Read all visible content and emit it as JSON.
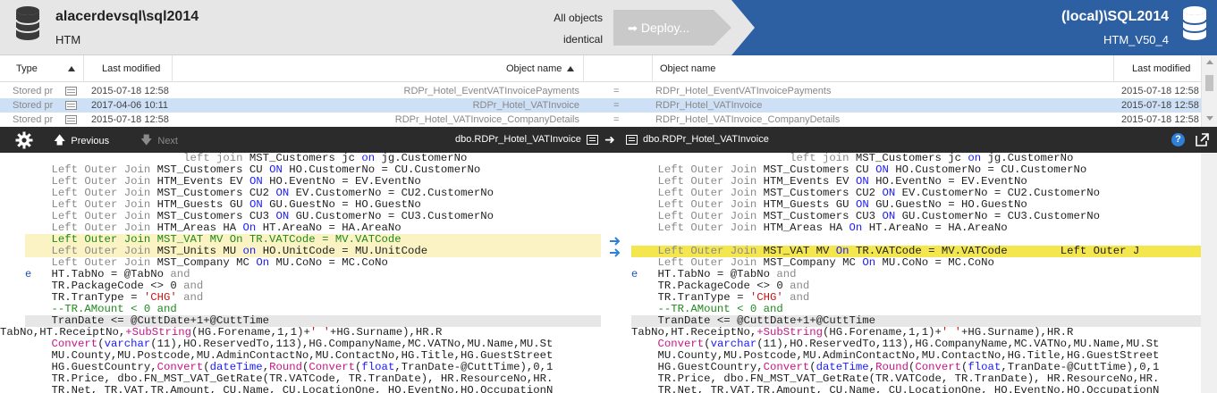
{
  "header": {
    "source_server": "alacerdevsql\\sql2014",
    "source_database": "HTM",
    "filter_label": "All objects",
    "filter_value": "identical",
    "deploy_label": "Deploy...",
    "target_server": "(local)\\SQL2014",
    "target_database": "HTM_V50_4",
    "colors": {
      "accent": "#2d5fa3",
      "header_bg": "#e6e6e6",
      "deploy_disabled": "#c9c9c9"
    }
  },
  "grid": {
    "columns": {
      "type": "Type",
      "left_modified": "Last modified",
      "left_name": "Object name",
      "right_name": "Object name",
      "right_modified": "Last modified"
    },
    "rows": [
      {
        "type": "Stored pr",
        "left_modified": "2015-07-18 12:58",
        "left_name": "RDPr_Hotel_EventVATInvoicePayments",
        "status": "=",
        "right_name": "RDPr_Hotel_EventVATInvoicePayments",
        "right_modified": "2015-07-18 12:58",
        "selected": false
      },
      {
        "type": "Stored pr",
        "left_modified": "2017-04-06 10:11",
        "left_name": "RDPr_Hotel_VATInvoice",
        "status": "=",
        "right_name": "RDPr_Hotel_VATInvoice",
        "right_modified": "2015-07-18 12:58",
        "selected": true
      },
      {
        "type": "Stored pr",
        "left_modified": "2015-07-18 12:58",
        "left_name": "RDPr_Hotel_VATInvoice_CompanyDetails",
        "status": "=",
        "right_name": "RDPr_Hotel_VATInvoice_CompanyDetails",
        "right_modified": "2015-07-18 12:58",
        "selected": false
      }
    ]
  },
  "toolbar": {
    "previous_label": "Previous",
    "next_label": "Next",
    "left_object": "dbo.RDPr_Hotel_VATInvoice",
    "right_object": "dbo.RDPr_Hotel_VATInvoice",
    "help_glyph": "?",
    "icons": [
      "gear-icon",
      "arrow-up-icon",
      "arrow-down-icon",
      "document-icon",
      "arrow-right-icon",
      "help-icon",
      "popout-icon"
    ]
  },
  "diff": {
    "left_lines": [
      "                        left join MST_Customers jc on jg.CustomerNo",
      "    Left Outer Join MST_Customers CU ON HO.CustomerNo = CU.CustomerNo",
      "    Left Outer Join HTM_Events EV ON HO.EventNo = EV.EventNo",
      "    Left Outer Join MST_Customers CU2 ON EV.CustomerNo = CU2.CustomerNo",
      "    Left Outer Join HTM_Guests GU ON GU.GuestNo = HO.GuestNo",
      "    Left Outer Join MST_Customers CU3 ON GU.CustomerNo = CU3.CustomerNo",
      "    Left Outer Join HTM_Areas HA On HT.AreaNo = HA.AreaNo",
      "    Left Outer Join MST_VAT MV On TR.VATCode = MV.VATCode",
      "    Left Outer Join MST_Units MU on HO.UnitCode = MU.UnitCode",
      "    Left Outer Join MST_Company MC On MU.CoNo = MC.CoNo",
      "    HT.TabNo = @TabNo and",
      "    TR.PackageCode <> 0 and",
      "    TR.TranType = 'CHG' and",
      "    --TR.AMount < 0 and",
      "    TranDate <= @CuttDate+1+@CuttTime",
      "TabNo,HT.ReceiptNo,(HG.Forename,1,1)+' '+HG.Surname),HR.R",
      "    Convert(varchar(11),HO.ReservedTo,113),HG.CompanyName,MC.VATNo,MU.Name,MU.St",
      "    MU.County,MU.Postcode,MU.AdminContactNo,MU.ContactNo,HG.Title,HG.GuestStreet",
      "    HG.GuestCountry,Convert(dateTime,Round(Convert(float,TranDate-@CuttTime),0,1",
      "    TR.Price, dbo.FN_MST_VAT_GetRate(TR.VATCode, TR.TranDate), HR.ResourceNo,HR.",
      "    TR.Net, TR.VAT,TR.Amount, CU.Name, CU.LocationOne, HO.EventNo,HO.OccupationN"
    ],
    "right_lines": [
      "                        left join MST_Customers jc on jg.CustomerNo",
      "    Left Outer Join MST_Customers CU ON HO.CustomerNo = CU.CustomerNo",
      "    Left Outer Join HTM_Events EV ON HO.EventNo = EV.EventNo",
      "    Left Outer Join MST_Customers CU2 ON EV.CustomerNo = CU2.CustomerNo",
      "    Left Outer Join HTM_Guests GU ON GU.GuestNo = HO.GuestNo",
      "    Left Outer Join MST_Customers CU3 ON GU.CustomerNo = CU3.CustomerNo",
      "    Left Outer Join HTM_Areas HA On HT.AreaNo = HA.AreaNo",
      "",
      "    Left Outer Join MST_VAT MV On TR.VATCode = MV.VATCode        Left Outer J",
      "    Left Outer Join MST_Company MC On MU.CoNo = MC.CoNo",
      "    HT.TabNo = @TabNo and",
      "    TR.PackageCode <> 0 and",
      "    TR.TranType = 'CHG' and",
      "    --TR.AMount < 0 and",
      "    TranDate <= @CuttDate+1+@CuttTime",
      "TabNo,HT.ReceiptNo,(HG.Forename,1,1)+' '+HG.Surname),HR.R",
      "    Convert(varchar(11),HO.ReservedTo,113),HG.CompanyName,MC.VATNo,MU.Name,MU.St",
      "    MU.County,MU.Postcode,MU.AdminContactNo,MU.ContactNo,HG.Title,HG.GuestStreet",
      "    HG.GuestCountry,Convert(dateTime,Round(Convert(float,TranDate-@CuttTime),0,1",
      "    TR.Price, dbo.FN_MST_VAT_GetRate(TR.VATCode, TR.TranDate), HR.ResourceNo,HR.",
      "    TR.Net, TR.VAT,TR.Amount, CU.Name, CU.LocationOne, HO.EventNo,HO.OccupationN"
    ],
    "left_margin_marker": "e",
    "right_margin_marker": "e"
  }
}
